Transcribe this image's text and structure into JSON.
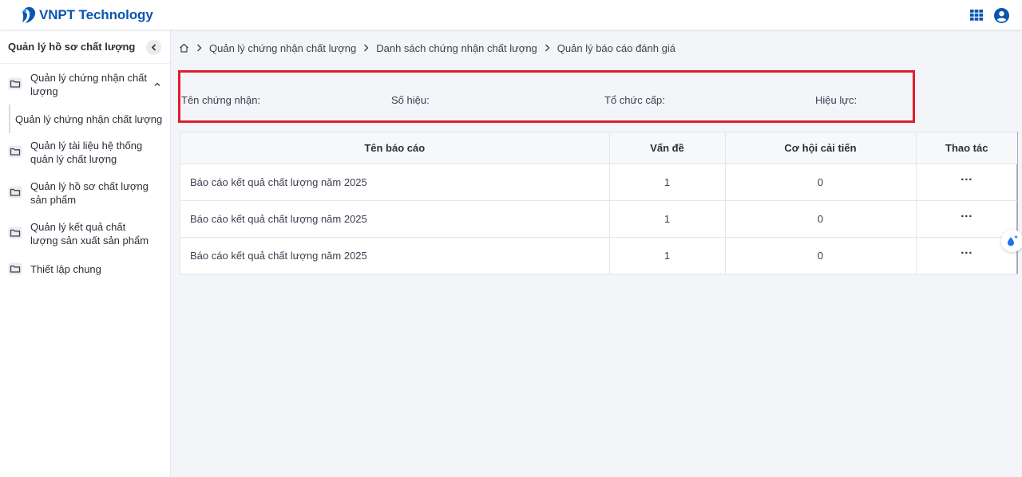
{
  "header": {
    "brand": "VNPT Technology",
    "icons": [
      "apps-grid-icon",
      "user-account-icon"
    ],
    "brand_color": "#0a56b0"
  },
  "sidebar": {
    "title": "Quản lý hồ sơ chất lượng",
    "items": [
      {
        "label": "Quản lý chứng nhận chất lượng",
        "icon": "folder-icon",
        "expanded": true
      },
      {
        "label": "Quản lý tài liệu hệ thống quản lý chất lượng",
        "icon": "folder-icon"
      },
      {
        "label": "Quản lý hồ sơ chất lượng sản phẩm",
        "icon": "folder-icon"
      },
      {
        "label": "Quản lý kết quả chất lượng sản xuất sản phẩm",
        "icon": "folder-icon"
      },
      {
        "label": "Thiết lập chung",
        "icon": "folder-icon"
      }
    ],
    "sub_items": [
      {
        "label": "Quản lý chứng nhận chất lượng"
      }
    ]
  },
  "breadcrumb": {
    "home_icon": "home-icon",
    "items": [
      "Quản lý chứng nhận chất lượng",
      "Danh sách chứng nhận chất lượng",
      "Quản lý báo cáo đánh giá"
    ]
  },
  "info": {
    "name_label": "Tên chứng nhận:",
    "number_label": "Số hiệu:",
    "issuer_label": "Tổ chức cấp:",
    "validity_label": "Hiệu lực:",
    "highlight_color": "#e01e2b"
  },
  "table": {
    "columns": [
      "Tên báo cáo",
      "Vấn đề",
      "Cơ hội cải tiến",
      "Thao tác"
    ],
    "rows": [
      {
        "name": "Báo cáo kết quả chất lượng năm 2025",
        "issues": "1",
        "opportunities": "0",
        "action": "···"
      },
      {
        "name": "Báo cáo kết quả chất lượng năm 2025",
        "issues": "1",
        "opportunities": "0",
        "action": "···"
      },
      {
        "name": "Báo cáo kết quả chất lượng năm 2025",
        "issues": "1",
        "opportunities": "0",
        "action": "···"
      }
    ]
  },
  "floating_button": {
    "icon": "water-drop-sparkle-icon",
    "color": "#1a73e8"
  }
}
